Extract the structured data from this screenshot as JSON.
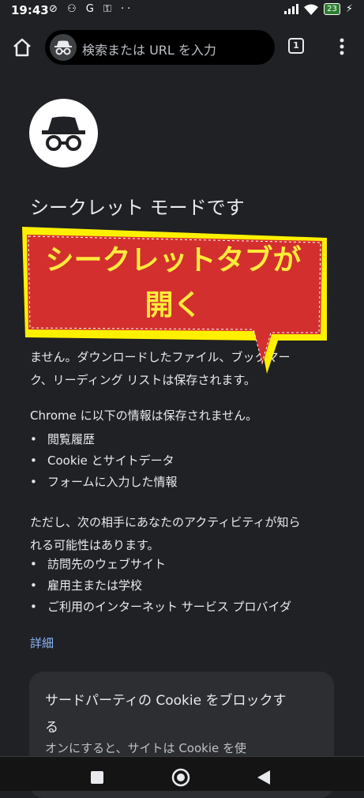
{
  "status_bar": {
    "time": "19:43",
    "left_icons": "⊘ ⚇ G ⚿ ··",
    "battery": "23"
  },
  "toolbar": {
    "search_placeholder": "検索または URL を入力",
    "tab_count": "1"
  },
  "content": {
    "title": "シークレット モードです",
    "para1_lines": [
      "ません。ダウンロードしたファイル、ブックマー",
      "ク、リーディング リストは保存されます。"
    ],
    "not_saved_heading": "Chrome に以下の情報は保存されません。",
    "not_saved_items": [
      "閲覧履歴",
      "Cookie とサイトデータ",
      "フォームに入力した情報"
    ],
    "visible_heading_lines": [
      "ただし、次の相手にあなたのアクティビティが知ら",
      "れる可能性はあります。"
    ],
    "visible_items": [
      "訪問先のウェブサイト",
      "雇用主または学校",
      "ご利用のインターネット サービス プロバイダ"
    ],
    "details_link": "詳細",
    "cookie_card": {
      "title": "サードパーティの Cookie をブロックする",
      "description": "オンにすると、サイトは Cookie を使"
    }
  },
  "overlay": {
    "line1": "シークレットタブが",
    "line2": "開く",
    "fill_color": "#d32f2f",
    "text_color": "#ffeb3b"
  },
  "icons": {
    "home": "home-icon",
    "incognito": "incognito-icon",
    "menu": "more-vert-icon",
    "nav": [
      "recent-apps-icon",
      "home-circle-icon",
      "back-triangle-icon"
    ]
  }
}
